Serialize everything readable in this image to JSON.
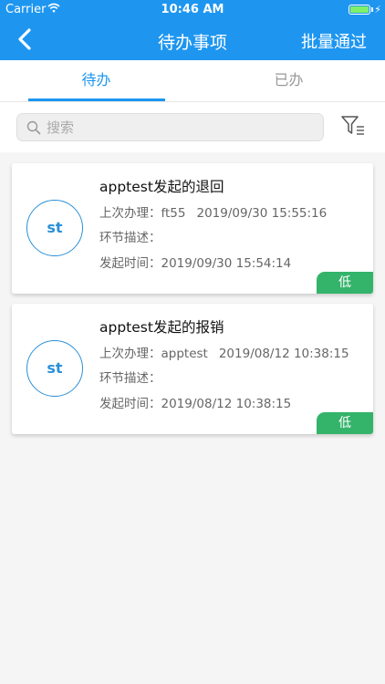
{
  "status_bar": {
    "carrier": "Carrier",
    "time": "10:46 AM",
    "bolt": "⚡"
  },
  "nav": {
    "title": "待办事项",
    "action_label": "批量通过"
  },
  "tabs": [
    {
      "label": "待办",
      "active": true
    },
    {
      "label": "已办",
      "active": false
    }
  ],
  "search": {
    "placeholder": "搜索",
    "value": ""
  },
  "icons": {
    "back": "chevron-left-icon",
    "search": "search-icon",
    "filter": "filter-icon",
    "wifi": "wifi-icon",
    "battery": "battery-icon"
  },
  "colors": {
    "primary": "#1e96f0",
    "avatar": "#2a8fd8",
    "priority_low": "#34b36a",
    "battery_fill": "#7ef06a"
  },
  "tasks": [
    {
      "avatar": "st",
      "title": "apptest发起的退回",
      "last_handle_label": "上次办理：",
      "last_handler": "ft55",
      "last_handle_time": "2019/09/30 15:55:16",
      "step_desc_label": "环节描述：",
      "step_desc": "",
      "start_time_label": "发起时间：",
      "start_time": "2019/09/30 15:54:14",
      "priority": "低"
    },
    {
      "avatar": "st",
      "title": "apptest发起的报销",
      "last_handle_label": "上次办理：",
      "last_handler": "apptest",
      "last_handle_time": "2019/08/12 10:38:15",
      "step_desc_label": "环节描述：",
      "step_desc": "",
      "start_time_label": "发起时间：",
      "start_time": "2019/08/12 10:38:15",
      "priority": "低"
    }
  ]
}
